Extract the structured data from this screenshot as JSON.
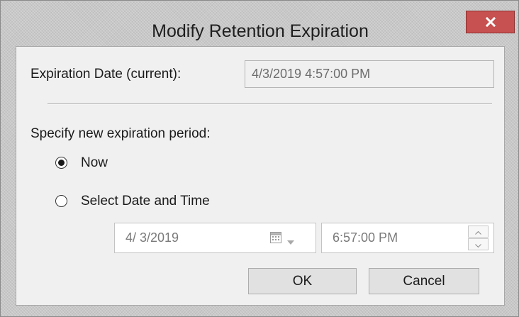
{
  "window": {
    "title": "Modify Retention Expiration",
    "close_label": "x"
  },
  "current_expiration": {
    "label": "Expiration Date (current):",
    "value": "4/3/2019 4:57:00 PM"
  },
  "new_period": {
    "heading": "Specify new expiration period:",
    "options": [
      {
        "label": "Now",
        "selected": true
      },
      {
        "label": "Select Date and Time",
        "selected": false
      }
    ],
    "date_value": "4/ 3/2019",
    "time_value": "6:57:00 PM"
  },
  "buttons": {
    "ok": "OK",
    "cancel": "Cancel"
  },
  "icons": {
    "close": "close-icon",
    "calendar": "calendar-icon",
    "dropdown": "chevron-down-icon",
    "spin_up": "chevron-up-icon",
    "spin_down": "chevron-down-icon"
  },
  "colors": {
    "close_button": "#c75050",
    "dialog_background": "#f0f0f0",
    "frame": "#c8c8c8"
  }
}
